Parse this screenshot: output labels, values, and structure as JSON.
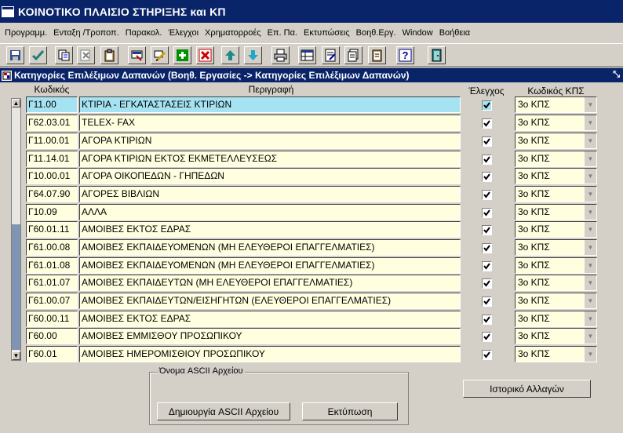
{
  "window": {
    "title": "ΚΟΙΝΟΤΙΚΟ ΠΛΑΙΣΙΟ ΣΤΗΡΙΞΗΣ και ΚΠ"
  },
  "menu": [
    "Προγραμμ.",
    "Ενταξη /Τροποπ.",
    "Παρακολ.",
    "Έλεγχοι",
    "Χρηματορροές",
    "Επ. Πα.",
    "Εκτυπώσεις",
    "Βοηθ.Εργ.",
    "Window",
    "Βοήθεια"
  ],
  "subwindow": {
    "title": "Κατηγορίες Επιλέξιμων Δαπανών (Βοηθ. Εργασίες -> Κατηγορίες Επιλέξιμων Δαπανών)"
  },
  "columns": {
    "code": "Κωδικός",
    "description": "Περιγραφή",
    "check": "Έλεγχος",
    "kps": "Κωδικός ΚΠΣ"
  },
  "rows": [
    {
      "code": "Γ11.00",
      "description": "ΚΤΙΡΙΑ - ΕΓΚΑΤΑΣΤΑΣΕΙΣ ΚΤΙΡΙΩΝ",
      "checked": true,
      "kps": "3ο ΚΠΣ"
    },
    {
      "code": "Γ62.03.01",
      "description": "TELEX- FAX",
      "checked": true,
      "kps": "3ο ΚΠΣ"
    },
    {
      "code": "Γ11.00.01",
      "description": "ΑΓΟΡΑ ΚΤΙΡΙΩΝ",
      "checked": true,
      "kps": "3ο ΚΠΣ"
    },
    {
      "code": "Γ11.14.01",
      "description": "ΑΓΟΡΑ ΚΤΙΡΙΩΝ ΕΚΤΟΣ ΕΚΜΕΤΕΛΛΕΥΣΕΩΣ",
      "checked": true,
      "kps": "3ο ΚΠΣ"
    },
    {
      "code": "Γ10.00.01",
      "description": "ΑΓΟΡΑ ΟΙΚΟΠΕΔΩΝ - ΓΗΠΕΔΩΝ",
      "checked": true,
      "kps": "3ο ΚΠΣ"
    },
    {
      "code": "Γ64.07.90",
      "description": "ΑΓΟΡΕΣ ΒΙΒΛΙΩΝ",
      "checked": true,
      "kps": "3ο ΚΠΣ"
    },
    {
      "code": "Γ10.09",
      "description": "ΑΛΛΑ",
      "checked": true,
      "kps": "3ο ΚΠΣ"
    },
    {
      "code": "Γ60.01.11",
      "description": "ΑΜΟΙΒΕΣ  ΕΚΤΟΣ ΕΔΡΑΣ",
      "checked": true,
      "kps": "3ο ΚΠΣ"
    },
    {
      "code": "Γ61.00.08",
      "description": "ΑΜΟΙΒΕΣ ΕΚΠΑΙΔΕΥΟΜΕΝΩΝ (ΜΗ ΕΛΕΥΘΕΡΟΙ ΕΠΑΓΓΕΛΜΑΤΙΕΣ)",
      "checked": true,
      "kps": "3ο ΚΠΣ"
    },
    {
      "code": "Γ61.01.08",
      "description": "ΑΜΟΙΒΕΣ ΕΚΠΑΙΔΕΥΟΜΕΝΩΝ (ΜΗ ΕΛΕΥΘΕΡΟΙ ΕΠΑΓΓΕΛΜΑΤΙΕΣ)",
      "checked": true,
      "kps": "3ο ΚΠΣ"
    },
    {
      "code": "Γ61.01.07",
      "description": "ΑΜΟΙΒΕΣ ΕΚΠΑΙΔΕΥΤΩΝ (ΜΗ ΕΛΕΥΘΕΡΟΙ ΕΠΑΓΓΕΛΜΑΤΙΕΣ)",
      "checked": true,
      "kps": "3ο ΚΠΣ"
    },
    {
      "code": "Γ61.00.07",
      "description": "ΑΜΟΙΒΕΣ ΕΚΠΑΙΔΕΥΤΩΝ/ΕΙΣΗΓΗΤΩΝ (ΕΛΕΥΘΕΡΟΙ ΕΠΑΓΓΕΛΜΑΤΙΕΣ)",
      "checked": true,
      "kps": "3ο ΚΠΣ"
    },
    {
      "code": "Γ60.00.11",
      "description": "ΑΜΟΙΒΕΣ ΕΚΤΟΣ ΕΔΡΑΣ",
      "checked": true,
      "kps": "3ο ΚΠΣ"
    },
    {
      "code": "Γ60.00",
      "description": "ΑΜΟΙΒΕΣ ΕΜΜΙΣΘΟΥ ΠΡΟΣΩΠΙΚΟΥ",
      "checked": true,
      "kps": "3ο ΚΠΣ"
    },
    {
      "code": "Γ60.01",
      "description": "ΑΜΟΙΒΕΣ ΗΜΕΡΟΜΙΣΘΙΟΥ ΠΡΟΣΩΠΙΚΟΥ",
      "checked": true,
      "kps": "3ο ΚΠΣ"
    }
  ],
  "ascii_group": {
    "title": "Όνομα ASCII Αρχείου",
    "create_button": "Δημιουργία  ASCII Αρχείου",
    "print_button": "Εκτύπωση"
  },
  "history_button": "Ιστορικό Αλλαγών",
  "colors": {
    "title_bar": "#0a246a",
    "field": "#ffffe0",
    "active_field": "#a6e3f2",
    "face": "#d4d0c8"
  }
}
